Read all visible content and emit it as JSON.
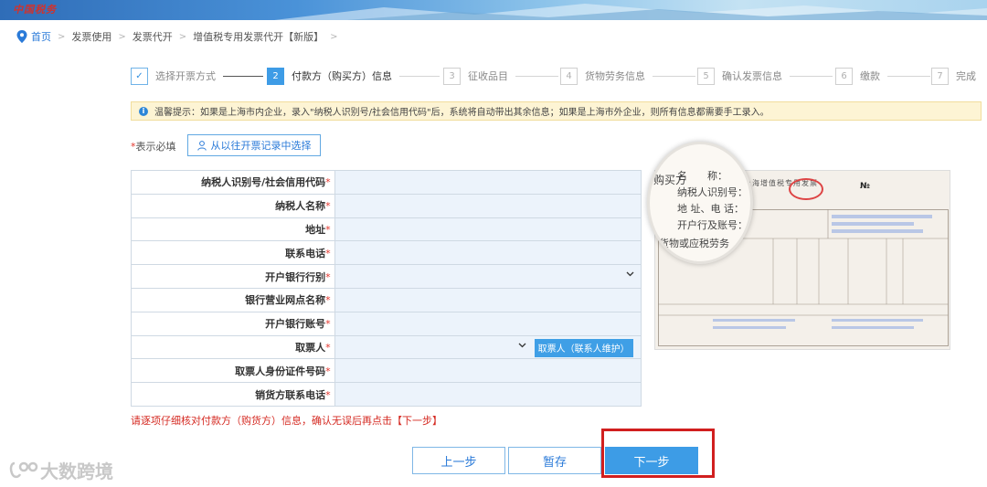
{
  "header": {
    "logo_text": "中国税务"
  },
  "breadcrumb": {
    "home": "首页",
    "items": [
      "发票使用",
      "发票代开",
      "增值税专用发票代开【新版】"
    ]
  },
  "steps": [
    {
      "num": "✓",
      "label": "选择开票方式",
      "state": "done"
    },
    {
      "num": "2",
      "label": "付款方（购买方）信息",
      "state": "active"
    },
    {
      "num": "3",
      "label": "征收品目",
      "state": "todo"
    },
    {
      "num": "4",
      "label": "货物劳务信息",
      "state": "todo"
    },
    {
      "num": "5",
      "label": "确认发票信息",
      "state": "todo"
    },
    {
      "num": "6",
      "label": "缴款",
      "state": "todo"
    },
    {
      "num": "7",
      "label": "完成",
      "state": "todo"
    }
  ],
  "notice": "温馨提示：如果是上海市内企业，录入\"纳税人识别号/社会信用代码\"后，系统将自动带出其余信息；如果是上海市外企业，则所有信息都需要手工录入。",
  "required_hint": {
    "star": "*",
    "text": "表示必填"
  },
  "history_button": "从以往开票记录中选择",
  "form": {
    "fields": [
      {
        "label": "纳税人识别号/社会信用代码",
        "value": ""
      },
      {
        "label": "纳税人名称",
        "value": ""
      },
      {
        "label": "地址",
        "value": ""
      },
      {
        "label": "联系电话",
        "value": ""
      },
      {
        "label": "开户银行行别",
        "value": ""
      },
      {
        "label": "银行营业网点名称",
        "value": ""
      },
      {
        "label": "开户银行账号",
        "value": ""
      },
      {
        "label": "取票人",
        "value": ""
      },
      {
        "label": "取票人身份证件号码",
        "value": ""
      },
      {
        "label": "销货方联系电话",
        "value": ""
      }
    ],
    "star": "*",
    "contact_button": "取票人（联系人维护）"
  },
  "invoice_sample": {
    "title": "上海增值税专用发票",
    "no_label": "№",
    "magnifier_lines": [
      "名　　称：",
      "纳税人识别号：",
      "地 址、电 话：",
      "开户行及账号：",
      "货物或应税劳务"
    ],
    "side_label": "购买方"
  },
  "warning": "请逐项仔细核对付款方（购货方）信息，确认无误后再点击【下一步】",
  "buttons": {
    "prev": "上一步",
    "save": "暂存",
    "next": "下一步"
  },
  "watermark": "大数跨境",
  "colors": {
    "accent": "#3d9ce6",
    "required": "#e3352c",
    "highlight": "#d11f1f"
  }
}
